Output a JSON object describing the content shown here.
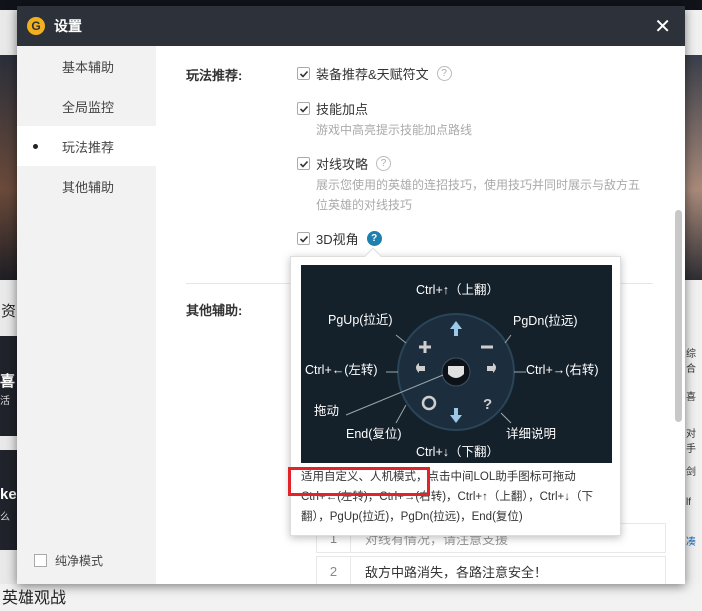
{
  "dialog": {
    "title": "设置",
    "close_icon": "close-icon",
    "logo_letter": "G"
  },
  "sidebar": {
    "items": [
      {
        "label": "基本辅助"
      },
      {
        "label": "全局监控"
      },
      {
        "label": "玩法推荐"
      },
      {
        "label": "其他辅助"
      }
    ],
    "pure_mode_label": "纯净模式"
  },
  "main": {
    "section_gameplay": "玩法推荐:",
    "section_other": "其他辅助:",
    "options": [
      {
        "label": "装备推荐&天赋符文",
        "checked": true,
        "help": "?"
      },
      {
        "label": "技能加点",
        "checked": true,
        "desc": "游戏中高亮提示技能加点路线"
      },
      {
        "label": "对线攻略",
        "checked": true,
        "help": "?",
        "desc": "展示您使用的英雄的连招技巧，使用技巧并同时展示与敌方五位英雄的对线技巧"
      },
      {
        "label": "3D视角",
        "checked": true,
        "help": "?"
      }
    ],
    "list_rows": [
      {
        "num": "1",
        "text": "对线有情况，请注意支援"
      },
      {
        "num": "2",
        "text": "敌方中路消失，各路注意安全！"
      }
    ]
  },
  "tooltip": {
    "wheel": {
      "up": "Ctrl+↑（上翻）",
      "down": "Ctrl+↓（下翻）",
      "left": "Ctrl+←(左转)",
      "right": "Ctrl+→(右转)",
      "pgup": "PgUp(拉近)",
      "pgdn": "PgDn(拉远)",
      "drag": "拖动",
      "end": "End(复位)",
      "detail": "详细说明"
    },
    "text_line1_highlight": "适用自定义、人机模式，",
    "text_line1_rest": "点击中间LOL助手图标可拖动",
    "text_line2": "Ctrl+←(左转)，Ctrl+→(右转)，Ctrl+↑（上翻），Ctrl+↓（下翻），PgUp(拉近)，PgDn(拉远)，End(复位)"
  },
  "background": {
    "left_char": "资",
    "left_char2": "喜",
    "left_char3": "活",
    "left_char4": "ke",
    "left_char5": "么",
    "bottom_text": "英雄观战",
    "right_texts": [
      "综合",
      "喜",
      "对手",
      "剑",
      "lf",
      "凑"
    ]
  },
  "colors": {
    "accent": "#f2b01e",
    "titlebar": "#2d3139",
    "highlight_box": "#e0242a",
    "help_blue": "#1f7fae"
  }
}
